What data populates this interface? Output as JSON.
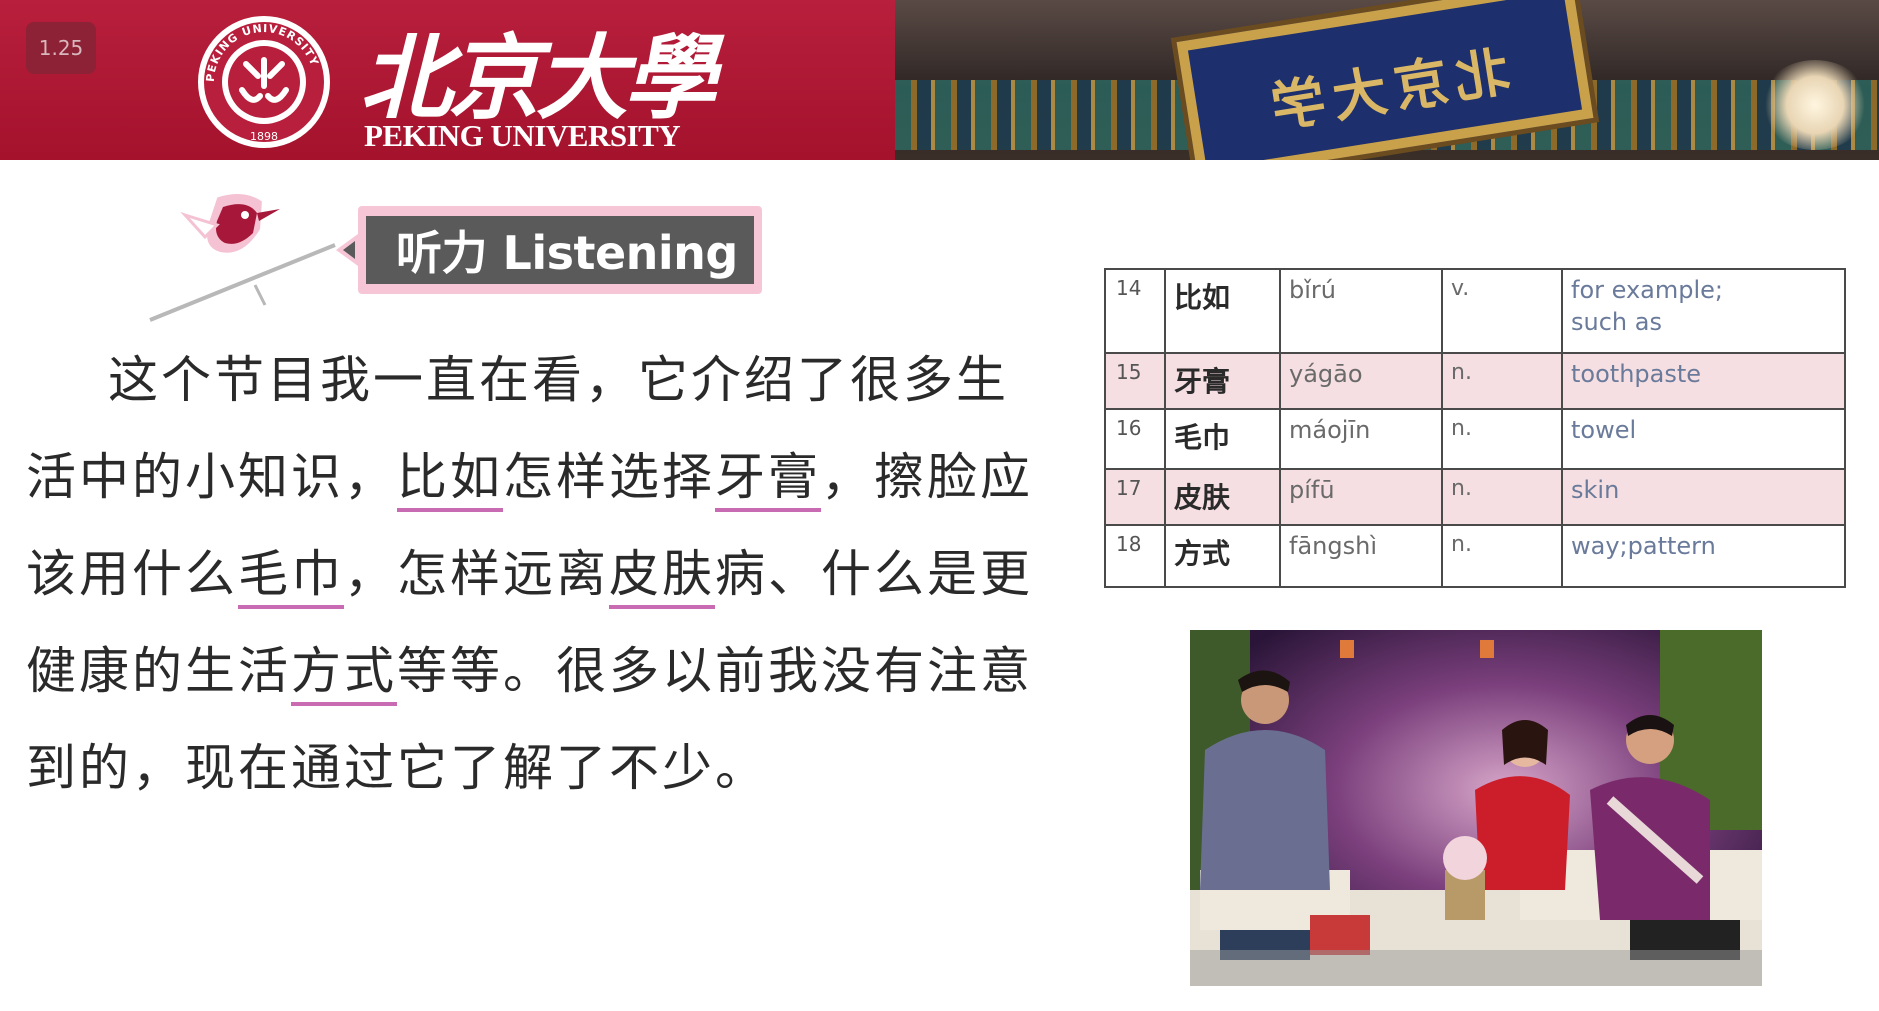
{
  "player": {
    "speed": "1.25"
  },
  "header": {
    "logo_cn": "北京大學",
    "logo_en": "PEKING UNIVERSITY",
    "seal_text": "PEKING UNIVERSITY",
    "seal_year": "1898",
    "plaque_text": "北京大学"
  },
  "section": {
    "title": "听力 Listening"
  },
  "passage": {
    "lines": [
      [
        {
          "t": "这个节目我一直在看，它介绍了很多生"
        }
      ],
      [
        {
          "t": "活中的小知识，"
        },
        {
          "t": "比如",
          "hl": true
        },
        {
          "t": "怎样选择"
        },
        {
          "t": "牙膏",
          "hl": true
        },
        {
          "t": "，擦脸应"
        }
      ],
      [
        {
          "t": "该用什么"
        },
        {
          "t": "毛巾",
          "hl": true
        },
        {
          "t": "，怎样远离"
        },
        {
          "t": "皮肤",
          "hl": true
        },
        {
          "t": "病、什么是更"
        }
      ],
      [
        {
          "t": "健康的生活"
        },
        {
          "t": "方式",
          "hl": true
        },
        {
          "t": "等等。很多以前我没有注意"
        }
      ],
      [
        {
          "t": "到的，现在通过它了解了不少。"
        }
      ]
    ]
  },
  "vocab": {
    "rows": [
      {
        "num": "14",
        "word": "比如",
        "pinyin": "bǐrú",
        "pos": "v.",
        "meaning": "for example;",
        "meaning2": "such as"
      },
      {
        "num": "15",
        "word": "牙膏",
        "pinyin": "yágāo",
        "pos": "n.",
        "meaning": "toothpaste"
      },
      {
        "num": "16",
        "word": "毛巾",
        "pinyin": "máojīn",
        "pos": "n.",
        "meaning": "towel"
      },
      {
        "num": "17",
        "word": "皮肤",
        "pinyin": "pífū",
        "pos": "n.",
        "meaning": "skin"
      },
      {
        "num": "18",
        "word": "方式",
        "pinyin": "fāngshì",
        "pos": "n.",
        "meaning": "way;pattern"
      }
    ]
  },
  "colors": {
    "brand_red": "#b81f3c",
    "highlight_underline": "#c86bb3",
    "tab_pink": "#f6c6d6",
    "row_pink": "#f6dfe2"
  }
}
